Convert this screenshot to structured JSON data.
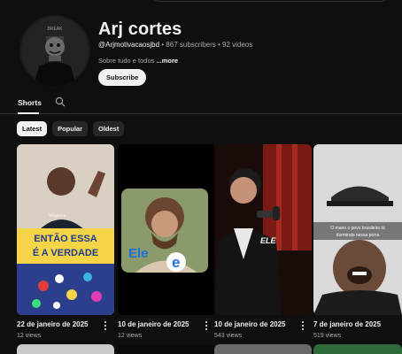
{
  "channel": {
    "name": "Arj cortes",
    "handle": "@Arjmotivacaosjbd",
    "stats": " • 867 subscribers • 92 videos",
    "description": "Sobre tudo e todos ",
    "more_label": "...more",
    "subscribe_label": "Subscribe",
    "avatar_text": "BREAK"
  },
  "tabs": [
    {
      "label": "Shorts",
      "active": true
    }
  ],
  "filters": [
    {
      "label": "Latest",
      "active": true
    },
    {
      "label": "Popular",
      "active": false
    },
    {
      "label": "Oldest",
      "active": false
    }
  ],
  "shorts": [
    {
      "date": "22 de janeiro de 2025",
      "views": "12 views",
      "overlay_lines": [
        "ENTÃO ESSA",
        "É A VERDADE"
      ],
      "logo_text": "Wharton"
    },
    {
      "date": "10 de janeiro de 2025",
      "views": "12 views",
      "overlay_text": "Ele"
    },
    {
      "date": "10 de janeiro de 2025",
      "views": "543 views",
      "overlay_text": "ELE"
    },
    {
      "date": "7 de janeiro de 2025",
      "views": "519 views",
      "caption_lines": [
        "O mano o povo brasileiro tá",
        "dormindo nessa porra"
      ]
    }
  ],
  "colors": {
    "background": "#0f0f0f",
    "chip": "#272727",
    "text_secondary": "#aaaaaa",
    "overlay_yellow": "#f5d547",
    "overlay_blue": "#1e6fd9"
  }
}
